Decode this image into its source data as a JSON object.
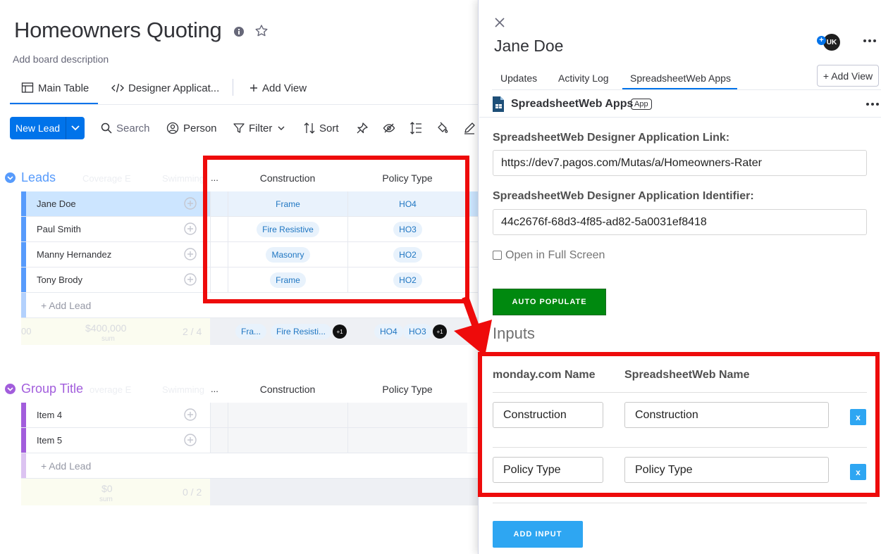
{
  "board": {
    "title": "Homeowners Quoting",
    "description": "Add board description",
    "tabs": {
      "main": "Main Table",
      "designer": "Designer Applicat...",
      "add_view": "Add View"
    }
  },
  "toolbar": {
    "new_item": "New Lead",
    "search": "Search",
    "person": "Person",
    "filter": "Filter",
    "sort": "Sort"
  },
  "groups": [
    {
      "title": "Leads",
      "color": "#579bfc",
      "ghost_cols": [
        "Coverage E",
        "Swimming"
      ],
      "ellipsis": "...",
      "columns": [
        "Construction",
        "Policy Type"
      ],
      "rows": [
        {
          "name": "Jane Doe",
          "construction": "Frame",
          "policy": "HO4"
        },
        {
          "name": "Paul Smith",
          "construction": "Fire Resistive",
          "policy": "HO3"
        },
        {
          "name": "Manny Hernandez",
          "construction": "Masonry",
          "policy": "HO2"
        },
        {
          "name": "Tony Brody",
          "construction": "Frame",
          "policy": "HO2"
        }
      ],
      "add_label": "+ Add Lead",
      "summary": {
        "left": "00",
        "sum_value": "$400,000",
        "sum_label": "sum",
        "count": "2 / 4",
        "construction_pills": [
          "Fra...",
          "Fire Resisti..."
        ],
        "construction_more": "+1",
        "policy_pills": [
          "HO4",
          "HO3"
        ],
        "policy_more": "+1"
      }
    },
    {
      "title": "Group Title",
      "color": "#a25ddc",
      "ghost_cols": [
        "overage E",
        "Swimming"
      ],
      "ellipsis": "...",
      "columns": [
        "Construction",
        "Policy Type"
      ],
      "rows": [
        {
          "name": "Item 4"
        },
        {
          "name": "Item 5"
        }
      ],
      "add_label": "+ Add Lead",
      "summary": {
        "sum_value": "$0",
        "sum_label": "sum",
        "count": "0 / 2"
      }
    }
  ],
  "panel": {
    "item_title": "Jane Doe",
    "avatar": "UK",
    "plus": "+",
    "tabs": [
      "Updates",
      "Activity Log",
      "SpreadsheetWeb Apps"
    ],
    "add_view": "+ Add View",
    "app_name": "SpreadsheetWeb Apps",
    "app_badge": "App",
    "link_label": "SpreadsheetWeb Designer Application Link:",
    "link_value": "https://dev7.pagos.com/Mutas/a/Homeowners-Rater",
    "ident_label": "SpreadsheetWeb Designer Application Identifier:",
    "ident_value": "44c2676f-68d3-4f85-ad82-5a0031ef8418",
    "fullscreen_label": "Open in Full Screen",
    "auto_populate": "AUTO POPULATE",
    "inputs_heading": "Inputs",
    "col_monday": "monday.com Name",
    "col_sheet": "SpreadsheetWeb Name",
    "mappings": [
      {
        "monday": "Construction",
        "sheet": "Construction",
        "remove": "x"
      },
      {
        "monday": "Policy Type",
        "sheet": "Policy Type",
        "remove": "x"
      }
    ],
    "add_input": "ADD INPUT"
  },
  "colors": {
    "primary": "#0073ea",
    "highlight": "#ee0b0b",
    "auto_btn": "#00890f",
    "sw_blue": "#2ea6f2"
  }
}
